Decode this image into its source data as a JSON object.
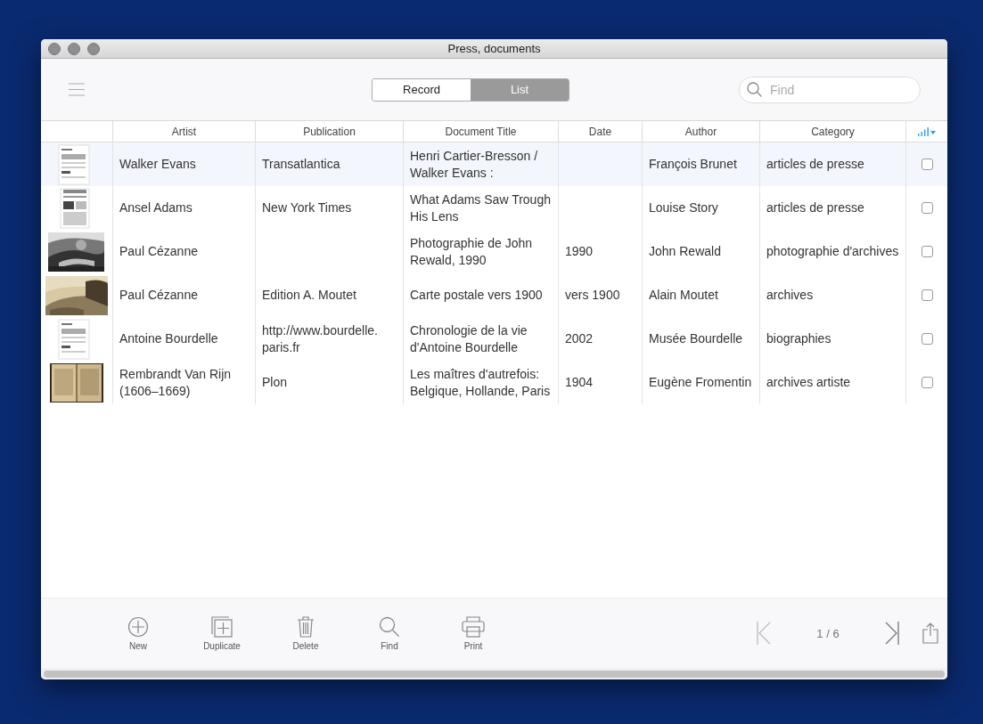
{
  "window": {
    "title": "Press, documents"
  },
  "view_switch": [
    {
      "label": "Record",
      "selected": false
    },
    {
      "label": "List",
      "selected": true
    }
  ],
  "search": {
    "placeholder": "Find"
  },
  "table": {
    "columns": [
      "Artist",
      "Publication",
      "Document Title",
      "Date",
      "Author",
      "Category"
    ],
    "rows": [
      {
        "thumbnail": {
          "kind": "page"
        },
        "selected": true,
        "checked": false,
        "artist": "Walker Evans",
        "publication": "Transatlantica",
        "title": "Henri Cartier-Bresson / Walker Evans :",
        "author": "François Brunet",
        "category": "articles de presse"
      },
      {
        "thumbnail": {
          "kind": "newspaper"
        },
        "selected": false,
        "checked": false,
        "artist": "Ansel Adams",
        "publication": "New York Times",
        "title": "What Adams Saw Trough His Lens",
        "author": "Louise Story",
        "category": "articles de presse"
      },
      {
        "thumbnail": {
          "kind": "photo-bw"
        },
        "selected": false,
        "checked": false,
        "artist": "Paul Cézanne",
        "title": "Photographie de John Rewald, 1990",
        "date": "1990",
        "author": "John Rewald",
        "category": "photographie d'archives"
      },
      {
        "thumbnail": {
          "kind": "photo-sepia"
        },
        "selected": false,
        "checked": false,
        "artist": "Paul Cézanne",
        "publication": "Edition A. Moutet",
        "title": "Carte postale vers 1900",
        "date": "vers 1900",
        "author": "Alain Moutet",
        "category": "archives"
      },
      {
        "thumbnail": {
          "kind": "page"
        },
        "selected": false,
        "checked": false,
        "artist": "Antoine Bourdelle",
        "publication": "http://www.bourdelle. paris.fr",
        "title": "Chronologie de la vie d'Antoine Bourdelle",
        "date": "2002",
        "author": "Musée Bourdelle",
        "category": "biographies"
      },
      {
        "thumbnail": {
          "kind": "book"
        },
        "selected": false,
        "checked": false,
        "artist": "Rembrandt Van Rijn (1606–1669)",
        "publication": "Plon",
        "title": "Les maîtres d'autrefois: Belgique, Hollande, Paris",
        "date": "1904",
        "author": "Eugène Fromentin",
        "category": "archives artiste"
      }
    ]
  },
  "actions": [
    {
      "kind": "new",
      "label": "New"
    },
    {
      "kind": "duplicate",
      "label": "Duplicate"
    },
    {
      "kind": "delete",
      "label": "Delete"
    },
    {
      "kind": "find",
      "label": "Find"
    },
    {
      "kind": "print",
      "label": "Print"
    }
  ],
  "pager": {
    "position": "1 / 6"
  }
}
